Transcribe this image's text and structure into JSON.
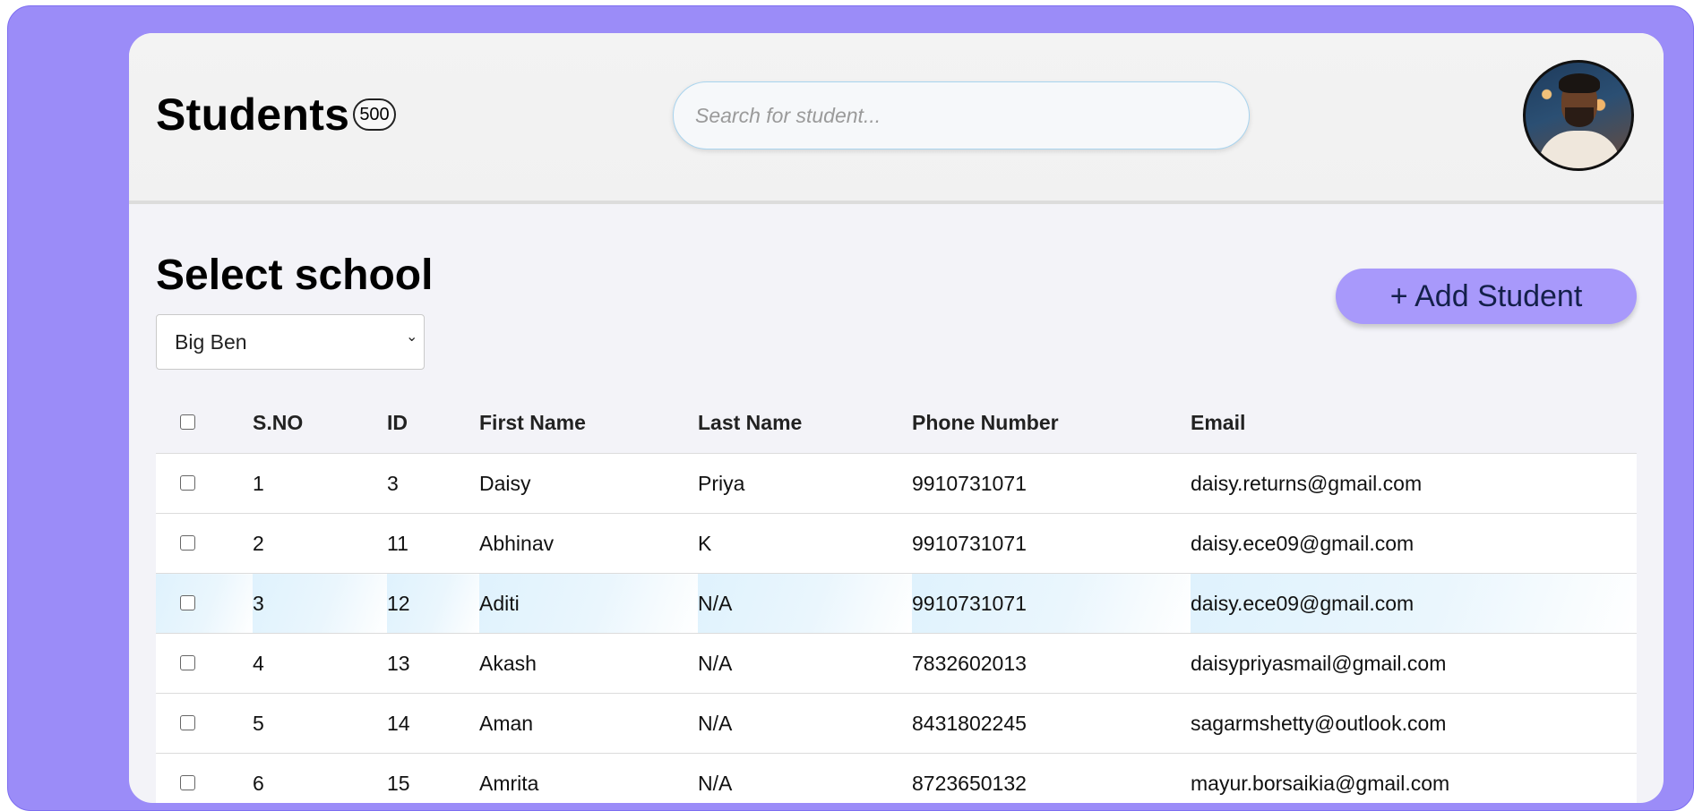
{
  "header": {
    "title": "Students",
    "count": "500",
    "search_placeholder": "Search for student..."
  },
  "school": {
    "label": "Select school",
    "selected": "Big Ben"
  },
  "actions": {
    "add_student": "+ Add Student"
  },
  "table": {
    "columns": [
      "S.NO",
      "ID",
      "First Name",
      "Last Name",
      "Phone Number",
      "Email"
    ],
    "rows": [
      {
        "sno": "1",
        "id": "3",
        "first": "Daisy",
        "last": "Priya",
        "phone": "9910731071",
        "email": "daisy.returns@gmail.com"
      },
      {
        "sno": "2",
        "id": "11",
        "first": "Abhinav",
        "last": "K",
        "phone": "9910731071",
        "email": "daisy.ece09@gmail.com"
      },
      {
        "sno": "3",
        "id": "12",
        "first": "Aditi",
        "last": "N/A",
        "phone": "9910731071",
        "email": "daisy.ece09@gmail.com"
      },
      {
        "sno": "4",
        "id": "13",
        "first": "Akash",
        "last": "N/A",
        "phone": "7832602013",
        "email": "daisypriyasmail@gmail.com"
      },
      {
        "sno": "5",
        "id": "14",
        "first": "Aman",
        "last": "N/A",
        "phone": "8431802245",
        "email": "sagarmshetty@outlook.com"
      },
      {
        "sno": "6",
        "id": "15",
        "first": "Amrita",
        "last": "N/A",
        "phone": "8723650132",
        "email": "mayur.borsaikia@gmail.com"
      }
    ]
  },
  "colors": {
    "frame": "#9b8cf8",
    "accent_button": "#a899fb",
    "row_highlight": "#dff2fd"
  }
}
